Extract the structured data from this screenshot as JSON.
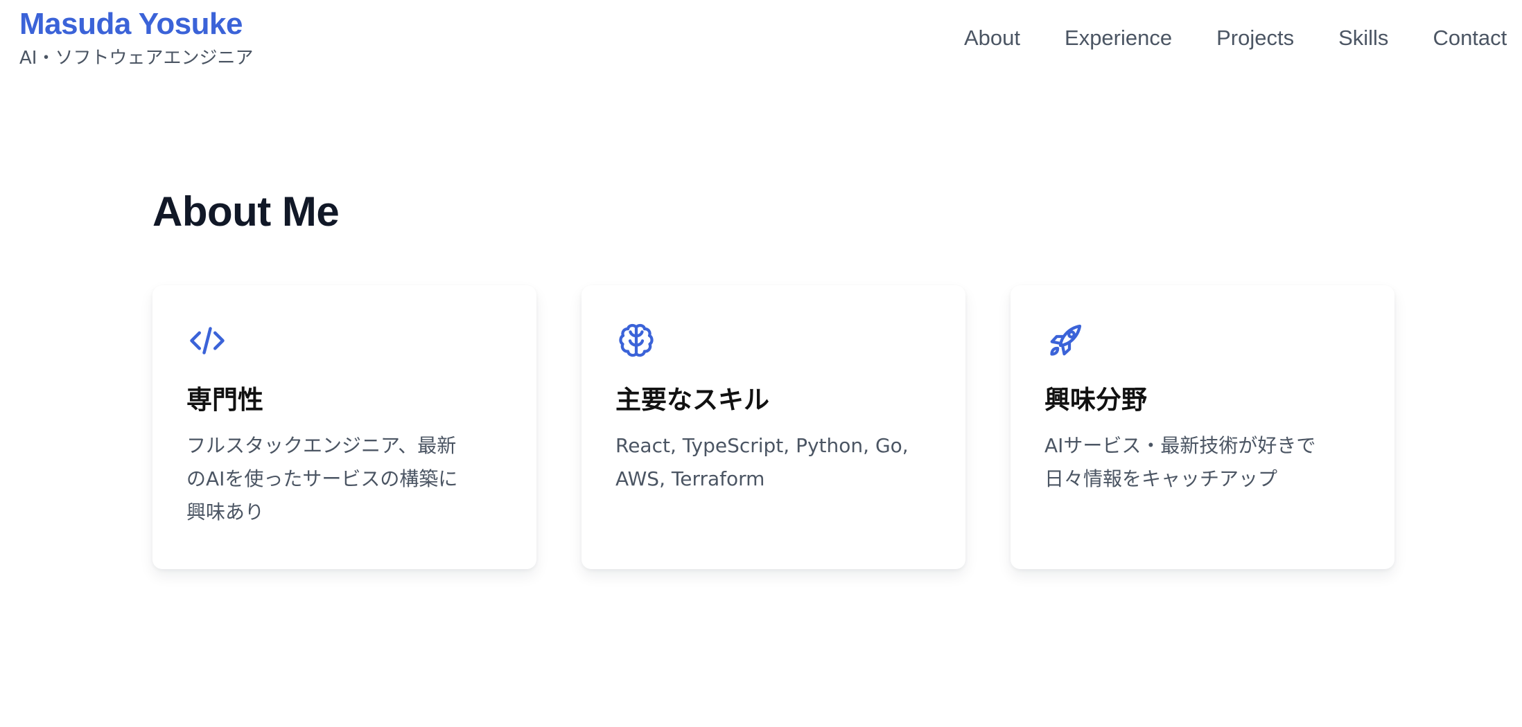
{
  "header": {
    "brand_name": "Masuda Yosuke",
    "tagline": "AI・ソフトウェアエンジニア",
    "nav": [
      "About",
      "Experience",
      "Projects",
      "Skills",
      "Contact"
    ]
  },
  "about": {
    "title": "About Me",
    "cards": [
      {
        "icon": "code-icon",
        "title": "専門性",
        "lines": [
          "フルスタックエンジニア、最新",
          "のAIを使ったサービスの構築に",
          "興味あり"
        ]
      },
      {
        "icon": "brain-icon",
        "title": "主要なスキル",
        "lines": [
          "React, TypeScript, Python, Go,",
          "AWS, Terraform"
        ]
      },
      {
        "icon": "rocket-icon",
        "title": "興味分野",
        "lines": [
          "AIサービス・最新技術が好きで",
          "日々情報をキャッチアップ"
        ]
      }
    ]
  },
  "colors": {
    "accent": "#3b63d8",
    "heading": "#111827",
    "muted_text": "#4b5563",
    "background": "#ffffff"
  }
}
